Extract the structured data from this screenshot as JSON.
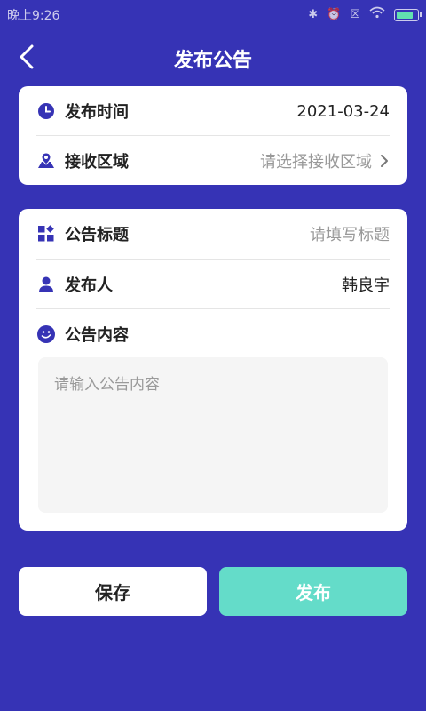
{
  "status_bar": {
    "time": "晚上9:26"
  },
  "header": {
    "title": "发布公告"
  },
  "card1": {
    "publish_time_label": "发布时间",
    "publish_time_value": "2021-03-24",
    "region_label": "接收区域",
    "region_placeholder": "请选择接收区域"
  },
  "card2": {
    "title_label": "公告标题",
    "title_placeholder": "请填写标题",
    "publisher_label": "发布人",
    "publisher_value": "韩良宇",
    "content_label": "公告内容",
    "content_placeholder": "请输入公告内容"
  },
  "buttons": {
    "save": "保存",
    "publish": "发布"
  },
  "colors": {
    "accent": "#3633b5",
    "publish": "#64dcc9"
  }
}
